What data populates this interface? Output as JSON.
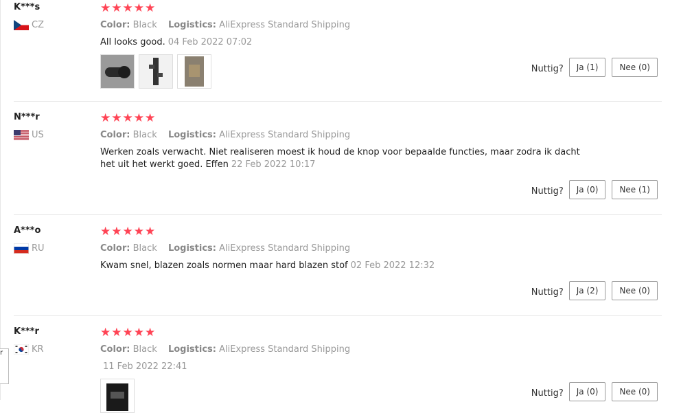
{
  "labels": {
    "color_key": "Color:",
    "logistics_key": "Logistics:",
    "helpful": "Nuttig?"
  },
  "reviews": [
    {
      "name": "K***s",
      "country": "CZ",
      "stars": "★★★★★",
      "color": "Black",
      "logistics": "AliExpress Standard Shipping",
      "text": "All looks good.",
      "date": "04 Feb 2022 07:02",
      "yes": "Ja (1)",
      "no": "Nee (0)"
    },
    {
      "name": "N***r",
      "country": "US",
      "stars": "★★★★★",
      "color": "Black",
      "logistics": "AliExpress Standard Shipping",
      "text": "Werken zoals verwacht. Niet realiseren moest ik houd de knop voor bepaalde functies, maar zodra ik dacht het uit het werkt goed. Effen",
      "date": "22 Feb 2022 10:17",
      "yes": "Ja (0)",
      "no": "Nee (1)"
    },
    {
      "name": "A***o",
      "country": "RU",
      "stars": "★★★★★",
      "color": "Black",
      "logistics": "AliExpress Standard Shipping",
      "text": "Kwam snel, blazen zoals normen maar hard blazen stof",
      "date": "02 Feb 2022 12:32",
      "yes": "Ja (2)",
      "no": "Nee (0)"
    },
    {
      "name": "K***r",
      "country": "KR",
      "stars": "★★★★★",
      "color": "Black",
      "logistics": "AliExpress Standard Shipping",
      "text": "",
      "date": "11 Feb 2022 22:41",
      "yes": "Ja (0)",
      "no": "Nee (0)"
    }
  ],
  "side_tab": "r"
}
